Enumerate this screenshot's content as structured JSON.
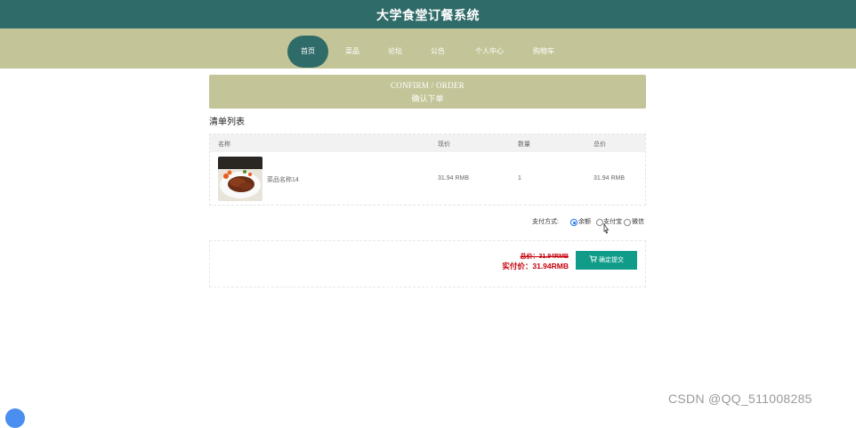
{
  "header": {
    "title": "大学食堂订餐系统"
  },
  "nav": {
    "items": [
      "首页",
      "菜品",
      "论坛",
      "公告",
      "个人中心",
      "购物车"
    ]
  },
  "banner": {
    "en": "CONFIRM / ORDER",
    "cn": "确认下单"
  },
  "list": {
    "title": "清单列表",
    "columns": [
      "名称",
      "现价",
      "数量",
      "总价"
    ],
    "rows": [
      {
        "name": "菜品名称14",
        "price": "31.94 RMB",
        "qty": "1",
        "total": "31.94 RMB"
      }
    ]
  },
  "payment": {
    "label": "支付方式:",
    "options": [
      "余额",
      "支付宝",
      "微信"
    ],
    "selected": "余额"
  },
  "summary": {
    "total": "总价：31.94RMB",
    "actual": "实付价：31.94RMB",
    "submit_label": "确定提交"
  },
  "watermark": "CSDN @QQ_511008285",
  "colors": {
    "header": "#2f6b68",
    "nav": "#c3c598",
    "button": "#119c8a",
    "price": "#c4000a"
  },
  "icons": {
    "submit": "cart-icon"
  }
}
